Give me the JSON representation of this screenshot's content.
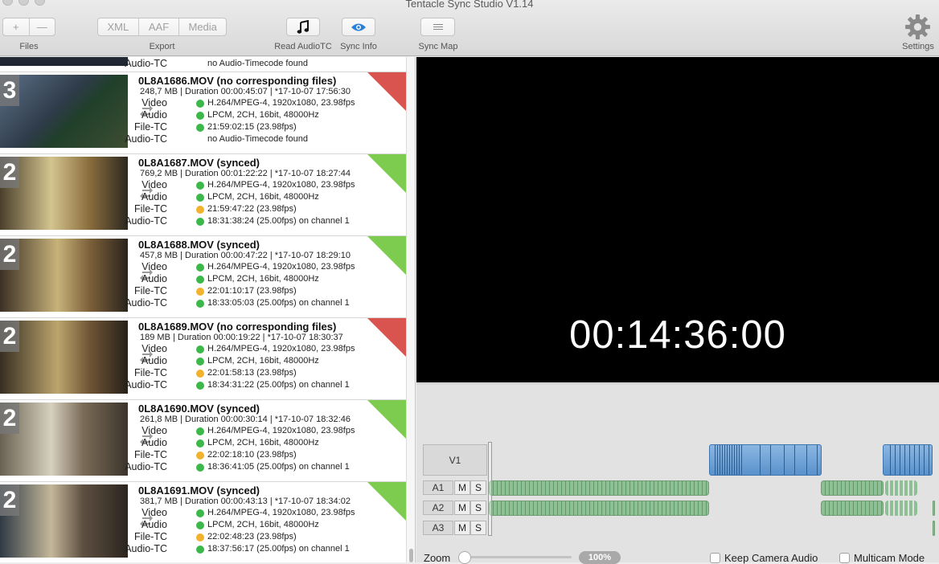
{
  "app": {
    "title": "Tentacle Sync Studio V1.14"
  },
  "toolbar": {
    "files": {
      "add": "+",
      "remove": "—",
      "label": "Files"
    },
    "export": {
      "xml": "XML",
      "aaf": "AAF",
      "media": "Media",
      "label": "Export"
    },
    "read_audio_tc": {
      "label": "Read AudioTC",
      "icon": "music-note-icon"
    },
    "sync_info": {
      "label": "Sync Info",
      "icon": "eye-icon",
      "accent": "#2a7fd6"
    },
    "sync_map": {
      "label": "Sync Map",
      "icon": "list-icon"
    },
    "settings": {
      "label": "Settings",
      "icon": "gear-icon"
    }
  },
  "partial_clip": {
    "audio_tc_label": "Audio-TC",
    "audio_tc_value": "no Audio-Timecode found"
  },
  "clips": [
    {
      "badge": "3",
      "title": "0L8A1686.MOV (no corresponding files)",
      "meta": "248,7 MB | Duration 00:00:45:07 | *17-10-07 17:56:30",
      "status": "red",
      "video_label": "Video",
      "video": "H.264/MPEG-4, 1920x1080, 23.98fps",
      "audio_label": "Audio",
      "audio": "LPCM, 2CH, 16bit, 48000Hz",
      "filetc_label": "File-TC",
      "filetc": "21:59:02:15 (23.98fps)",
      "filetc_dot": "green",
      "audiotc_label": "Audio-TC",
      "audiotc": "no Audio-Timecode found",
      "audiotc_dot": "none"
    },
    {
      "badge": "2",
      "title": "0L8A1687.MOV (synced)",
      "meta": "769,2 MB | Duration 00:01:22:22 | *17-10-07 18:27:44",
      "status": "green",
      "video_label": "Video",
      "video": "H.264/MPEG-4, 1920x1080, 23.98fps",
      "audio_label": "Audio",
      "audio": "LPCM, 2CH, 16bit, 48000Hz",
      "filetc_label": "File-TC",
      "filetc": "21:59:47:22 (23.98fps)",
      "filetc_dot": "orange",
      "audiotc_label": "Audio-TC",
      "audiotc": "18:31:38:24 (25.00fps) on channel 1",
      "audiotc_dot": "green"
    },
    {
      "badge": "2",
      "title": "0L8A1688.MOV (synced)",
      "meta": "457,8 MB | Duration 00:00:47:22 | *17-10-07 18:29:10",
      "status": "green",
      "video_label": "Video",
      "video": "H.264/MPEG-4, 1920x1080, 23.98fps",
      "audio_label": "Audio",
      "audio": "LPCM, 2CH, 16bit, 48000Hz",
      "filetc_label": "File-TC",
      "filetc": "22:01:10:17 (23.98fps)",
      "filetc_dot": "orange",
      "audiotc_label": "Audio-TC",
      "audiotc": "18:33:05:03 (25.00fps) on channel 1",
      "audiotc_dot": "green"
    },
    {
      "badge": "2",
      "title": "0L8A1689.MOV (no corresponding files)",
      "meta": "189 MB | Duration 00:00:19:22 | *17-10-07 18:30:37",
      "status": "red",
      "video_label": "Video",
      "video": "H.264/MPEG-4, 1920x1080, 23.98fps",
      "audio_label": "Audio",
      "audio": "LPCM, 2CH, 16bit, 48000Hz",
      "filetc_label": "File-TC",
      "filetc": "22:01:58:13 (23.98fps)",
      "filetc_dot": "orange",
      "audiotc_label": "Audio-TC",
      "audiotc": "18:34:31:22 (25.00fps) on channel 1",
      "audiotc_dot": "green"
    },
    {
      "badge": "2",
      "title": "0L8A1690.MOV (synced)",
      "meta": "261,8 MB | Duration 00:00:30:14 | *17-10-07 18:32:46",
      "status": "green",
      "video_label": "Video",
      "video": "H.264/MPEG-4, 1920x1080, 23.98fps",
      "audio_label": "Audio",
      "audio": "LPCM, 2CH, 16bit, 48000Hz",
      "filetc_label": "File-TC",
      "filetc": "22:02:18:10 (23.98fps)",
      "filetc_dot": "orange",
      "audiotc_label": "Audio-TC",
      "audiotc": "18:36:41:05 (25.00fps) on channel 1",
      "audiotc_dot": "green"
    },
    {
      "badge": "2",
      "title": "0L8A1691.MOV (synced)",
      "meta": "381,7 MB | Duration 00:00:43:13 | *17-10-07 18:34:02",
      "status": "green",
      "video_label": "Video",
      "video": "H.264/MPEG-4, 1920x1080, 23.98fps",
      "audio_label": "Audio",
      "audio": "LPCM, 2CH, 16bit, 48000Hz",
      "filetc_label": "File-TC",
      "filetc": "22:02:48:23 (23.98fps)",
      "filetc_dot": "orange",
      "audiotc_label": "Audio-TC",
      "audiotc": "18:37:56:17 (25.00fps) on channel 1",
      "audiotc_dot": "green"
    }
  ],
  "colors": {
    "green": "#3cb84a",
    "orange": "#f1b32e",
    "red": "#d9534f",
    "status_green": "#7dcb4f"
  },
  "viewer": {
    "timecode": "00:14:36:00"
  },
  "timeline": {
    "tracks": {
      "v1": "V1",
      "a1": "A1",
      "a2": "A2",
      "a3": "A3",
      "mute": "M",
      "solo": "S"
    },
    "zoom_label": "Zoom",
    "zoom_value": "100%",
    "keep_camera_audio": "Keep Camera Audio",
    "multicam_mode": "Multicam Mode"
  }
}
